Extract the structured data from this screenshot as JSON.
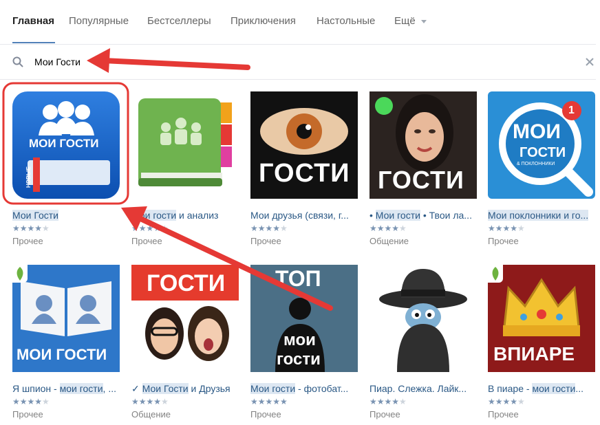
{
  "tabs": [
    {
      "label": "Главная",
      "active": true
    },
    {
      "label": "Популярные",
      "active": false
    },
    {
      "label": "Бестселлеры",
      "active": false
    },
    {
      "label": "Приключения",
      "active": false
    },
    {
      "label": "Настольные",
      "active": false
    },
    {
      "label": "Ещё",
      "active": false
    }
  ],
  "search": {
    "value": "Мои Гости",
    "placeholder": ""
  },
  "apps": [
    {
      "title": "Мои Гости",
      "highlight": "",
      "stars": 4,
      "category": "Прочее",
      "icon_text": "МОИ ГОСТИ",
      "icon_tag": "НОВЫЕ"
    },
    {
      "title_pre": "",
      "highlight": "Мои гости",
      "title_post": " и анализ",
      "stars": 4,
      "category": "Прочее"
    },
    {
      "title_pre": "Мои друзья (связи, г...",
      "highlight": "",
      "title_post": "",
      "stars": 4,
      "category": "Прочее",
      "icon_text": "ГОСТИ"
    },
    {
      "title_pre": "• ",
      "highlight": "Мои гости",
      "title_post": " • Твои ла...",
      "stars": 4,
      "category": "Общение",
      "icon_text": "ГОСТИ"
    },
    {
      "title_pre": "",
      "highlight": "Мои поклонники и го...",
      "title_post": "",
      "stars": 4,
      "category": "Прочее",
      "icon_text": "МОИ",
      "icon_text2": "ГОСТИ",
      "icon_text3": "& ПОКЛОННИКИ",
      "icon_badge": "1"
    },
    {
      "title_pre": "Я шпион - ",
      "highlight": "мои гости",
      "title_post": ", ...",
      "stars": 4,
      "category": "Прочее",
      "icon_text": "МОИ ГОСТИ"
    },
    {
      "title_pre": "✓ ",
      "highlight": "Мои Гости",
      "title_post": " и Друзья",
      "stars": 4,
      "category": "Общение",
      "icon_text": "ГОСТИ"
    },
    {
      "title_pre": "",
      "highlight": "Мои гости",
      "title_post": " - фотобат...",
      "stars": 5,
      "category": "Прочее",
      "icon_text": "ТОП",
      "icon_text2": "мои",
      "icon_text3": "гости"
    },
    {
      "title_pre": "Пиар. Слежка. Лайк...",
      "highlight": "",
      "title_post": "",
      "stars": 4,
      "category": "Прочее"
    },
    {
      "title_pre": "В пиаре - ",
      "highlight": "мои гости",
      "title_post": "...",
      "stars": 4,
      "category": "Прочее",
      "icon_text": "ВПИАРЕ"
    }
  ],
  "colors": {
    "accent": "#5181b8",
    "link": "#2a5885",
    "annotation": "#e53935"
  }
}
